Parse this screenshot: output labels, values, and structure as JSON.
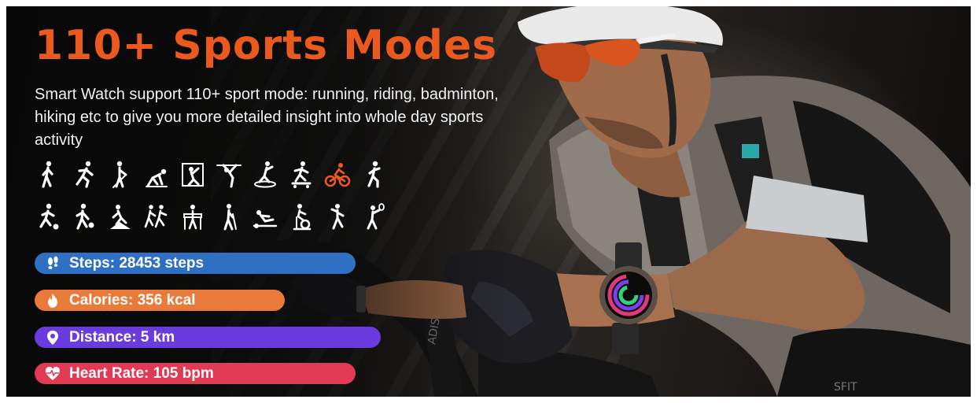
{
  "banner": {
    "title": "110+ Sports Modes",
    "description": "Smart Watch support 110+ sport mode: running, riding, badminton, hiking etc to give you more detailed insight into whole day sports activity",
    "accent_color": "#ea5a1e"
  },
  "sport_icons": {
    "row1": [
      "walking-icon",
      "running-icon",
      "golf-icon",
      "sprint-start-icon",
      "climbing-icon",
      "gymnastics-icon",
      "elliptical-icon",
      "skateboard-icon",
      "cycling-icon",
      "jogging-icon"
    ],
    "row2": [
      "soccer-icon",
      "basketball-icon",
      "hiking-icon",
      "couple-running-icon",
      "walker-icon",
      "nordic-walking-icon",
      "rowing-icon",
      "spinning-icon",
      "dance-icon",
      "tennis-icon"
    ],
    "highlighted": "cycling-icon",
    "highlight_color": "#ea5a1e"
  },
  "stats": [
    {
      "label": "Steps: 28453 steps",
      "icon": "footprints-icon",
      "color": "#2f6fc4"
    },
    {
      "label": "Calories: 356 kcal",
      "icon": "flame-icon",
      "color": "#ea7a3a"
    },
    {
      "label": "Distance: 5 km",
      "icon": "location-pin-icon",
      "color": "#6b3be0"
    },
    {
      "label": "Heart Rate: 105 bpm",
      "icon": "heart-pulse-icon",
      "color": "#e03a54"
    }
  ]
}
